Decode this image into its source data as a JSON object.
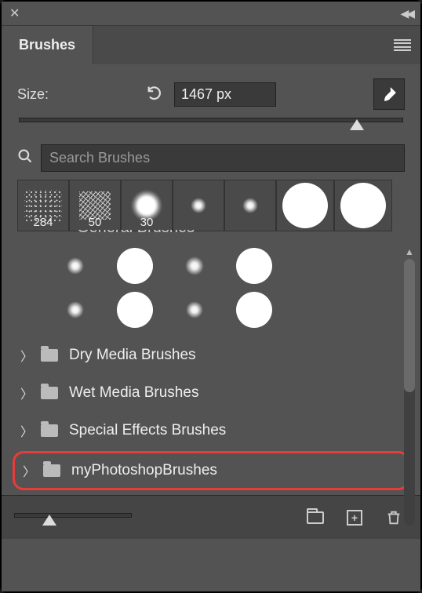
{
  "panel": {
    "tab_label": "Brushes"
  },
  "size": {
    "label": "Size:",
    "value": "1467 px",
    "slider_percent": 88
  },
  "search": {
    "placeholder": "Search Brushes"
  },
  "recent_brushes": [
    {
      "label": "284"
    },
    {
      "label": "50"
    },
    {
      "label": "30"
    },
    {
      "label": ""
    },
    {
      "label": ""
    },
    {
      "label": ""
    },
    {
      "label": ""
    }
  ],
  "cutoff_folder_label": "General Brushes",
  "folders": [
    {
      "label": "Dry Media Brushes"
    },
    {
      "label": "Wet Media Brushes"
    },
    {
      "label": "Special Effects Brushes"
    }
  ],
  "highlighted_folder": {
    "label": "myPhotoshopBrushes"
  },
  "footer": {
    "thumb_percent": 30
  }
}
